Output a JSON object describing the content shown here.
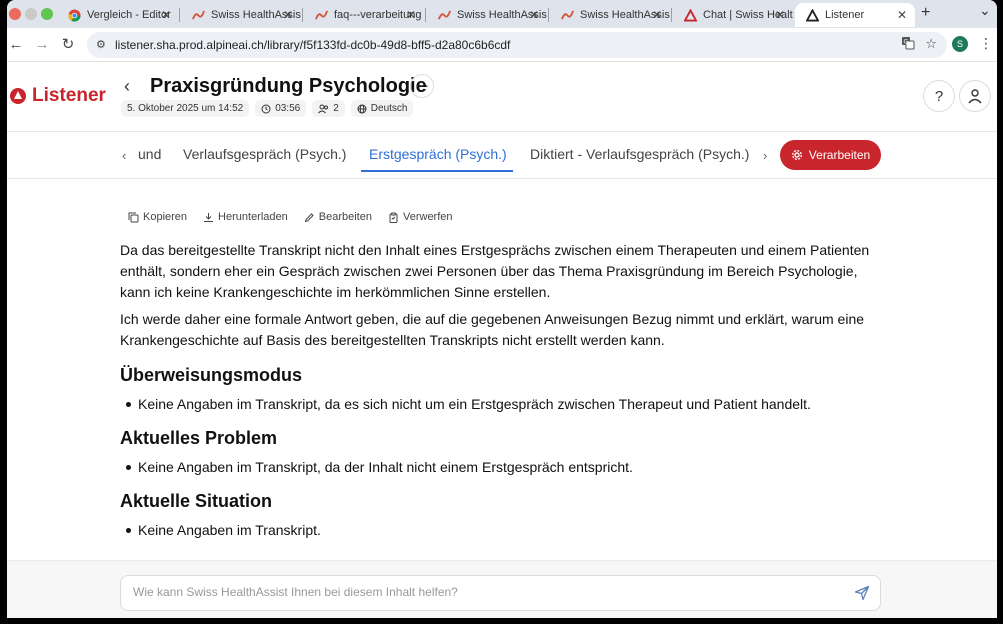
{
  "browser": {
    "tabs": [
      {
        "title": "Vergleich - Editor",
        "icon": "chrome-icon"
      },
      {
        "title": "Swiss HealthAssist",
        "icon": "wave-icon"
      },
      {
        "title": "faq---verarbeitung",
        "icon": "wave-icon"
      },
      {
        "title": "Swiss HealthAssist",
        "icon": "wave-icon"
      },
      {
        "title": "Swiss HealthAssist",
        "icon": "wave-icon"
      },
      {
        "title": "Chat | Swiss HealthAssist",
        "icon": "red-triangle-icon"
      },
      {
        "title": "Listener",
        "icon": "dark-triangle-icon",
        "active": true
      }
    ],
    "close_glyph": "✕",
    "new_tab_glyph": "+",
    "dropdown_glyph": "⌄",
    "url": "listener.sha.prod.alpineai.ch/library/f5f133fd-dc0b-49d8-bff5-d2a80c6b6cdf",
    "profile_initial": "S",
    "colors": {
      "tabstrip": "#dfe3eb",
      "omnibox": "#edf0f5",
      "profile": "#1e7a5b"
    }
  },
  "app": {
    "logo_text": "Listener",
    "brand_color": "#c9252c",
    "title": "Praxisgründung Psychologie",
    "meta": {
      "date": "5. Oktober 2025 um 14:52",
      "duration": "03:56",
      "speakers": "2",
      "language": "Deutsch"
    },
    "tabs": {
      "partial": "und",
      "items": [
        "Verlaufsgespräch (Psych.)",
        "Erstgespräch (Psych.)",
        "Diktiert - Verlaufsgespräch (Psych.)"
      ],
      "active_index": 1,
      "active_color": "#2f6fd6"
    },
    "process_button": "Verarbeiten",
    "actions": {
      "copy": "Kopieren",
      "download": "Herunterladen",
      "edit": "Bearbeiten",
      "discard": "Verwerfen"
    },
    "content": {
      "paragraphs": [
        "Da das bereitgestellte Transkript nicht den Inhalt eines Erstgesprächs zwischen einem Therapeuten und einem Patienten enthält, sondern eher ein Gespräch zwischen zwei Personen über das Thema Praxisgründung im Bereich Psychologie, kann ich keine Krankengeschichte im herkömmlichen Sinne erstellen.",
        "Ich werde daher eine formale Antwort geben, die auf die gegebenen Anweisungen Bezug nimmt und erklärt, warum eine Krankengeschichte auf Basis des bereitgestellten Transkripts nicht erstellt werden kann."
      ],
      "sections": [
        {
          "heading": "Überweisungsmodus",
          "bullet": "Keine Angaben im Transkript, da es sich nicht um ein Erstgespräch zwischen Therapeut und Patient handelt."
        },
        {
          "heading": "Aktuelles Problem",
          "bullet": "Keine Angaben im Transkript, da der Inhalt nicht einem Erstgespräch entspricht."
        },
        {
          "heading": "Aktuelle Situation",
          "bullet": "Keine Angaben im Transkript."
        }
      ]
    },
    "chat": {
      "placeholder": "Wie kann Swiss HealthAssist Ihnen bei diesem Inhalt helfen?"
    }
  }
}
